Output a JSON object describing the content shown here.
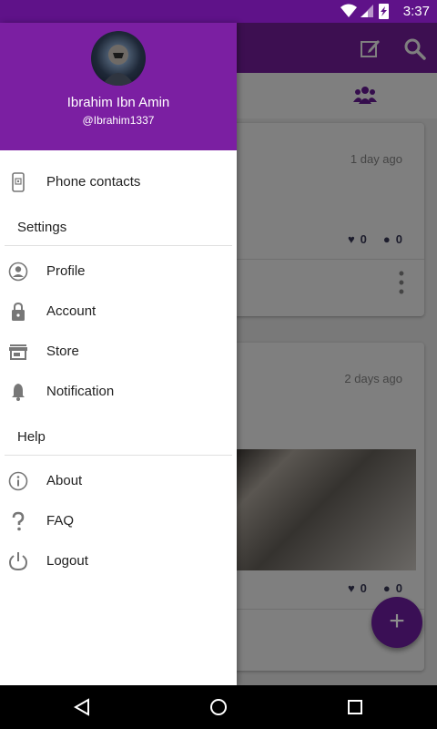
{
  "status_bar": {
    "time": "3:37"
  },
  "drawer": {
    "header": {
      "user_name": "Ibrahim Ibn Amin",
      "user_handle": "@Ibrahim1337"
    },
    "items": [
      {
        "label": "Phone contacts",
        "icon": "phone-contacts-icon"
      }
    ],
    "settings": {
      "header": "Settings",
      "items": [
        {
          "label": "Profile",
          "icon": "person-icon"
        },
        {
          "label": "Account",
          "icon": "lock-icon"
        },
        {
          "label": "Store",
          "icon": "store-icon"
        },
        {
          "label": "Notification",
          "icon": "bell-icon"
        }
      ]
    },
    "help": {
      "header": "Help",
      "items": [
        {
          "label": "About",
          "icon": "info-icon"
        },
        {
          "label": "FAQ",
          "icon": "question-icon"
        },
        {
          "label": "Logout",
          "icon": "power-icon"
        }
      ]
    }
  },
  "feed": {
    "posts": [
      {
        "time": "1 day ago",
        "likes": "0",
        "comments": "0"
      },
      {
        "time": "2 days ago",
        "likes": "0",
        "comments": "0"
      }
    ]
  },
  "fab": {
    "label": "+"
  },
  "colors": {
    "primary": "#7b1fa2",
    "primary_dark": "#5f1289",
    "accent": "#6a1b9a"
  }
}
